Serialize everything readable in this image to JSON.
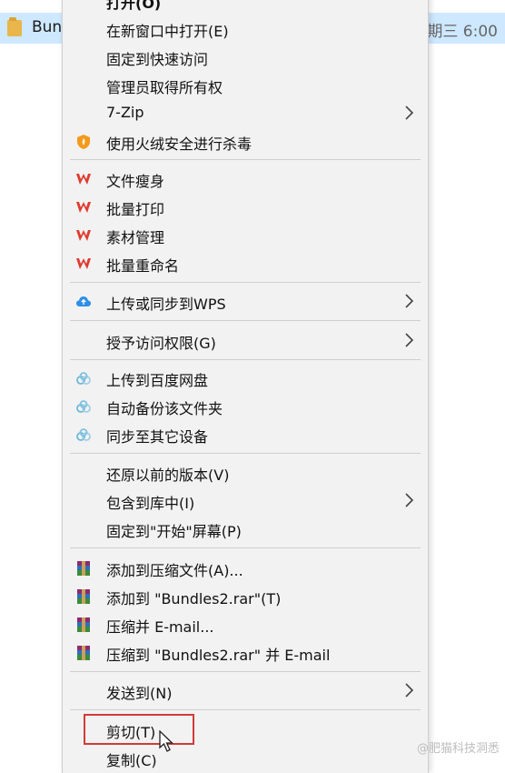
{
  "explorer": {
    "file_name": "Bun",
    "file_date": "期三 6:00"
  },
  "menu": {
    "items": [
      {
        "label": "打开(O)"
      },
      {
        "label": "在新窗口中打开(E)"
      },
      {
        "label": "固定到快速访问"
      },
      {
        "label": "管理员取得所有权"
      },
      {
        "label": "7-Zip"
      },
      {
        "label": "使用火绒安全进行杀毒"
      },
      {
        "label": "文件瘦身"
      },
      {
        "label": "批量打印"
      },
      {
        "label": "素材管理"
      },
      {
        "label": "批量重命名"
      },
      {
        "label": "上传或同步到WPS"
      },
      {
        "label": "授予访问权限(G)"
      },
      {
        "label": "上传到百度网盘"
      },
      {
        "label": "自动备份该文件夹"
      },
      {
        "label": "同步至其它设备"
      },
      {
        "label": "还原以前的版本(V)"
      },
      {
        "label": "包含到库中(I)"
      },
      {
        "label": "固定到\"开始\"屏幕(P)"
      },
      {
        "label": "添加到压缩文件(A)..."
      },
      {
        "label": "添加到 \"Bundles2.rar\"(T)"
      },
      {
        "label": "压缩并 E-mail..."
      },
      {
        "label": "压缩到 \"Bundles2.rar\" 并 E-mail"
      },
      {
        "label": "发送到(N)"
      },
      {
        "label": "剪切(T)"
      },
      {
        "label": "复制(C)"
      }
    ]
  },
  "watermark": "@肥猫科技洞悉",
  "colors": {
    "menu_bg": "#f2f2f2",
    "highlight_box": "#d23a3a",
    "wps_red": "#e03b2f",
    "upload_blue": "#2f8fe6"
  }
}
